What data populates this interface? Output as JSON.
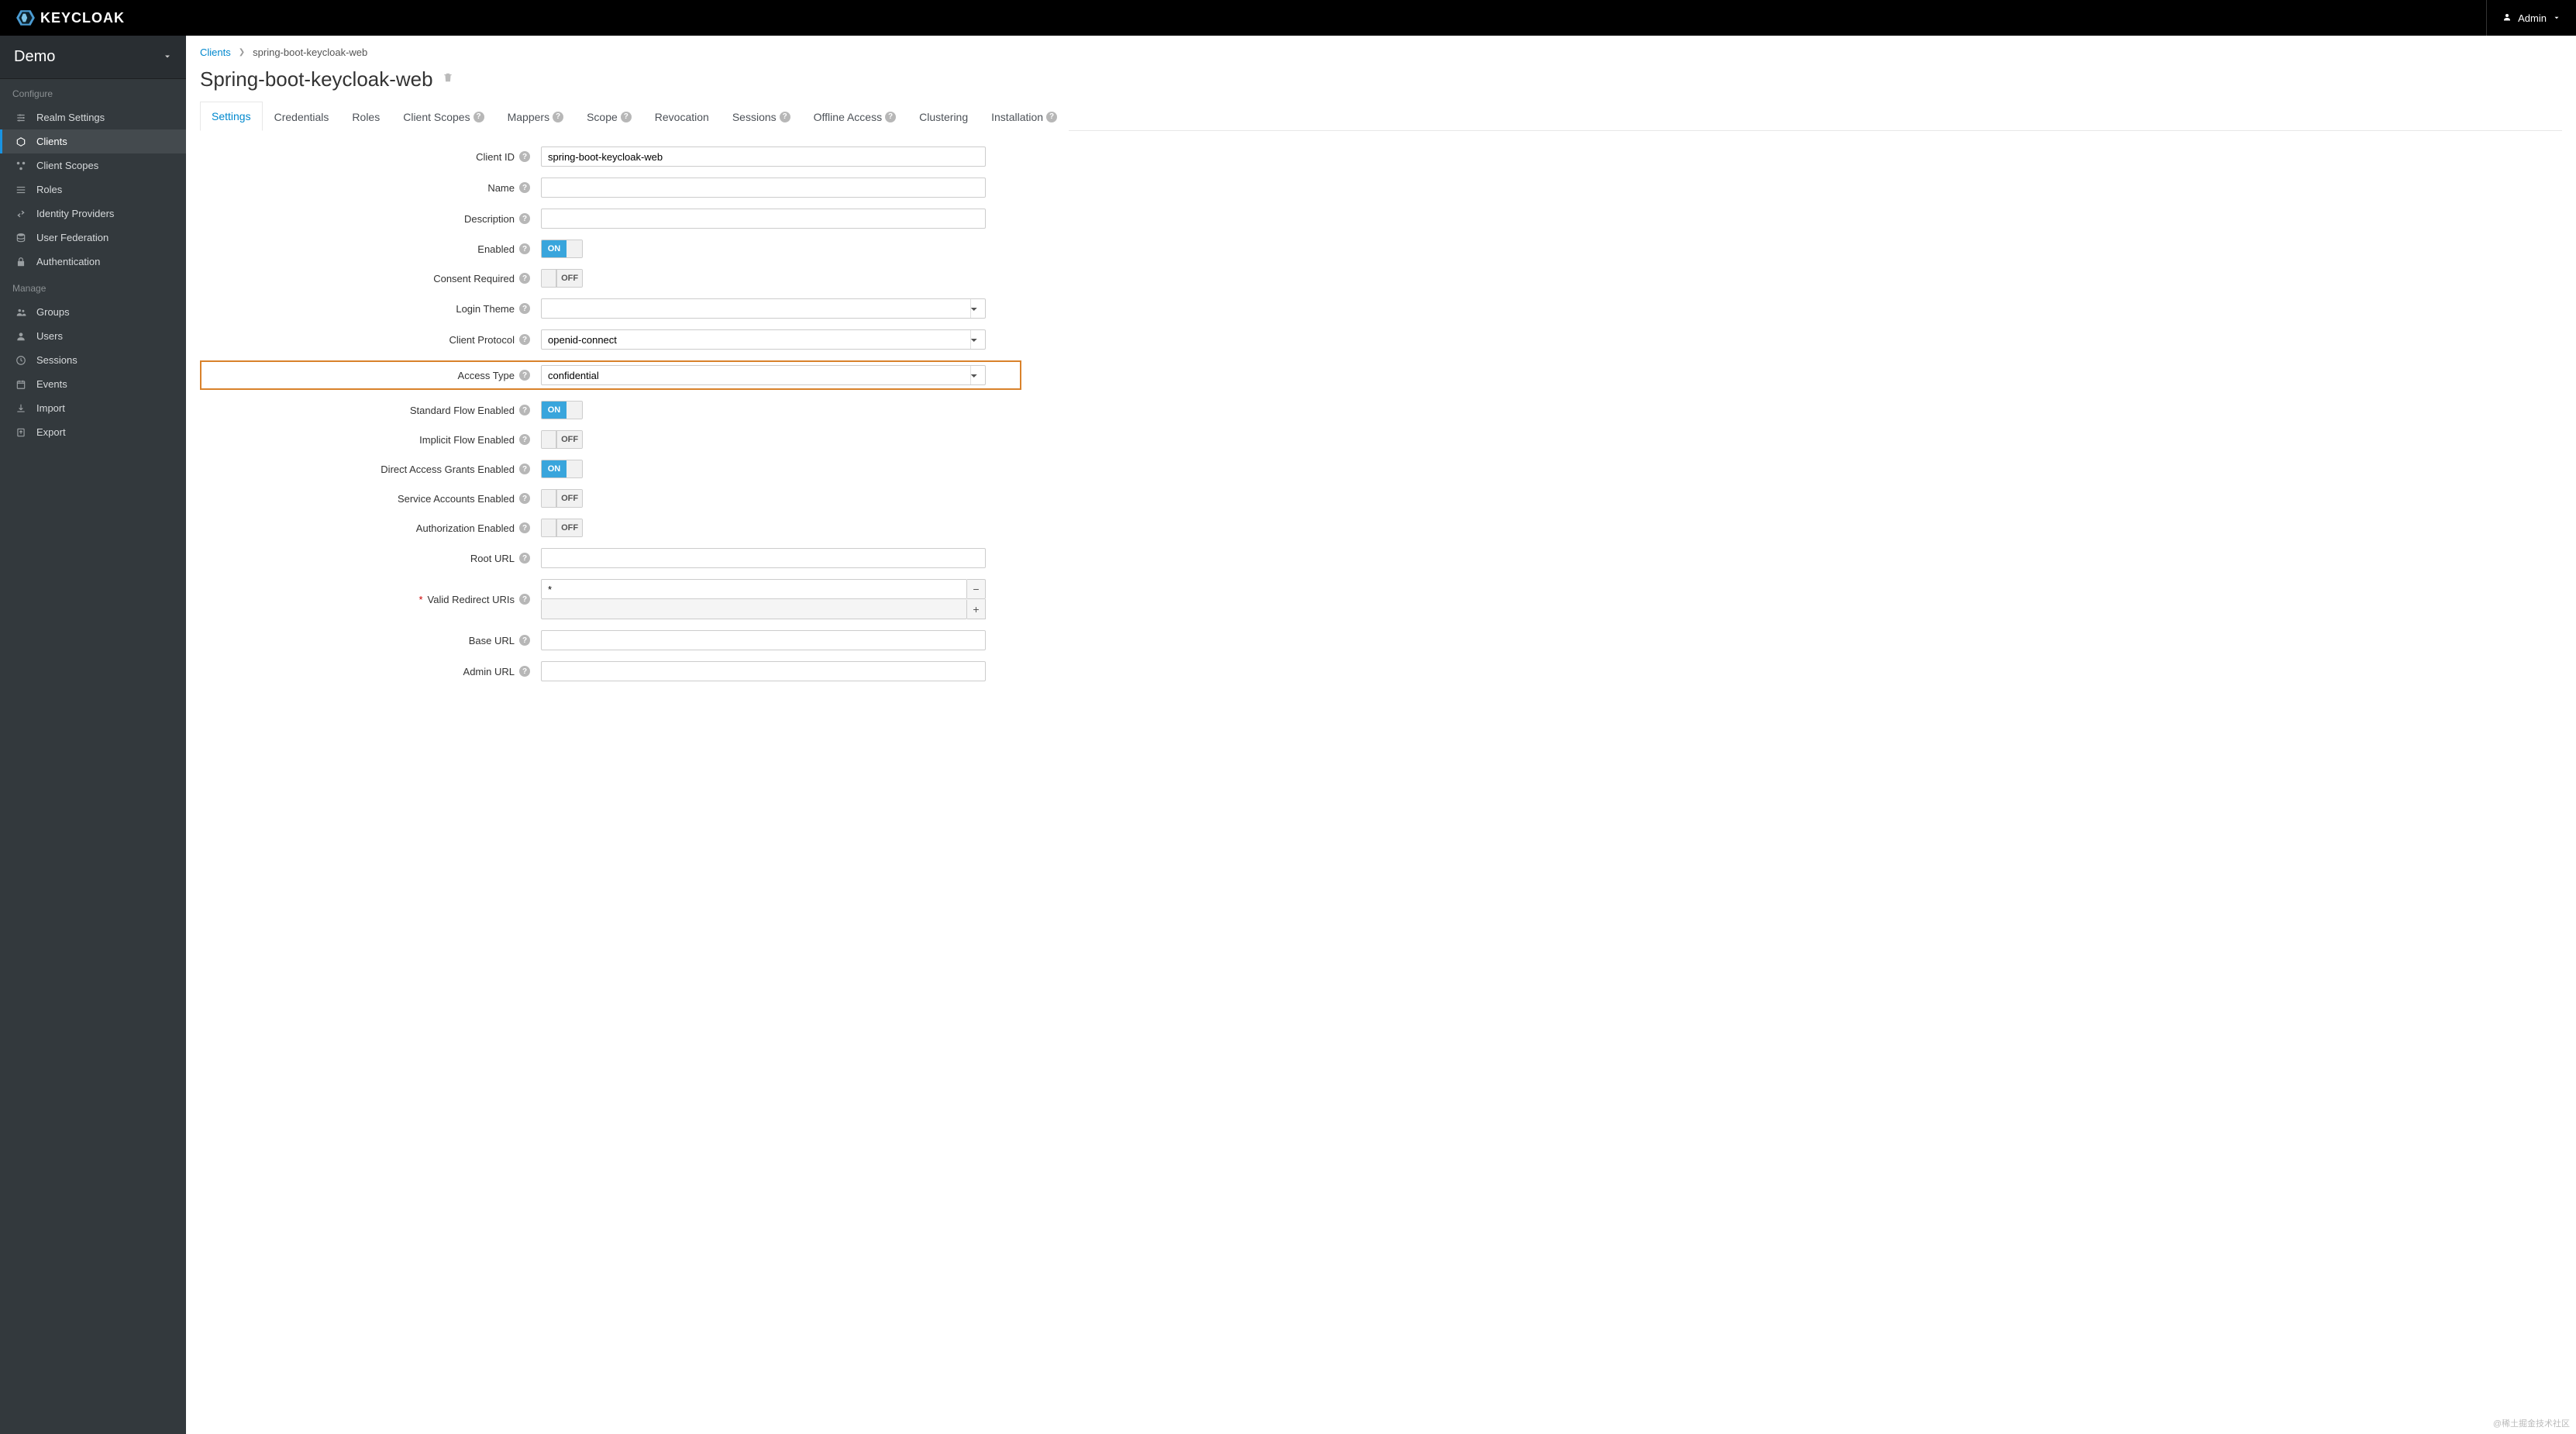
{
  "header": {
    "brand": "KEYCLOAK",
    "user_label": "Admin"
  },
  "sidebar": {
    "realm": "Demo",
    "sections": [
      {
        "title": "Configure",
        "items": [
          {
            "label": "Realm Settings",
            "icon": "sliders"
          },
          {
            "label": "Clients",
            "icon": "cube",
            "active": true
          },
          {
            "label": "Client Scopes",
            "icon": "scopes"
          },
          {
            "label": "Roles",
            "icon": "list"
          },
          {
            "label": "Identity Providers",
            "icon": "exchange"
          },
          {
            "label": "User Federation",
            "icon": "database"
          },
          {
            "label": "Authentication",
            "icon": "lock"
          }
        ]
      },
      {
        "title": "Manage",
        "items": [
          {
            "label": "Groups",
            "icon": "group"
          },
          {
            "label": "Users",
            "icon": "user"
          },
          {
            "label": "Sessions",
            "icon": "clock"
          },
          {
            "label": "Events",
            "icon": "calendar"
          },
          {
            "label": "Import",
            "icon": "import"
          },
          {
            "label": "Export",
            "icon": "export"
          }
        ]
      }
    ]
  },
  "breadcrumb": {
    "parent": "Clients",
    "current": "spring-boot-keycloak-web"
  },
  "page_title": "Spring-boot-keycloak-web",
  "tabs": [
    {
      "label": "Settings",
      "active": true
    },
    {
      "label": "Credentials"
    },
    {
      "label": "Roles"
    },
    {
      "label": "Client Scopes",
      "help": true
    },
    {
      "label": "Mappers",
      "help": true
    },
    {
      "label": "Scope",
      "help": true
    },
    {
      "label": "Revocation"
    },
    {
      "label": "Sessions",
      "help": true
    },
    {
      "label": "Offline Access",
      "help": true
    },
    {
      "label": "Clustering"
    },
    {
      "label": "Installation",
      "help": true
    }
  ],
  "form": {
    "client_id": {
      "label": "Client ID",
      "value": "spring-boot-keycloak-web"
    },
    "name": {
      "label": "Name",
      "value": ""
    },
    "description": {
      "label": "Description",
      "value": ""
    },
    "enabled": {
      "label": "Enabled",
      "value": true
    },
    "consent_required": {
      "label": "Consent Required",
      "value": false
    },
    "login_theme": {
      "label": "Login Theme",
      "value": ""
    },
    "client_protocol": {
      "label": "Client Protocol",
      "value": "openid-connect"
    },
    "access_type": {
      "label": "Access Type",
      "value": "confidential",
      "highlighted": true
    },
    "standard_flow": {
      "label": "Standard Flow Enabled",
      "value": true
    },
    "implicit_flow": {
      "label": "Implicit Flow Enabled",
      "value": false
    },
    "direct_access": {
      "label": "Direct Access Grants Enabled",
      "value": true
    },
    "service_accounts": {
      "label": "Service Accounts Enabled",
      "value": false
    },
    "authorization": {
      "label": "Authorization Enabled",
      "value": false
    },
    "root_url": {
      "label": "Root URL",
      "value": ""
    },
    "redirect_uris": {
      "label": "Valid Redirect URIs",
      "required": true,
      "values": [
        "*"
      ]
    },
    "base_url": {
      "label": "Base URL",
      "value": ""
    },
    "admin_url": {
      "label": "Admin URL",
      "value": ""
    }
  },
  "toggle_labels": {
    "on": "ON",
    "off": "OFF"
  },
  "watermark": "@稀土掘金技术社区"
}
